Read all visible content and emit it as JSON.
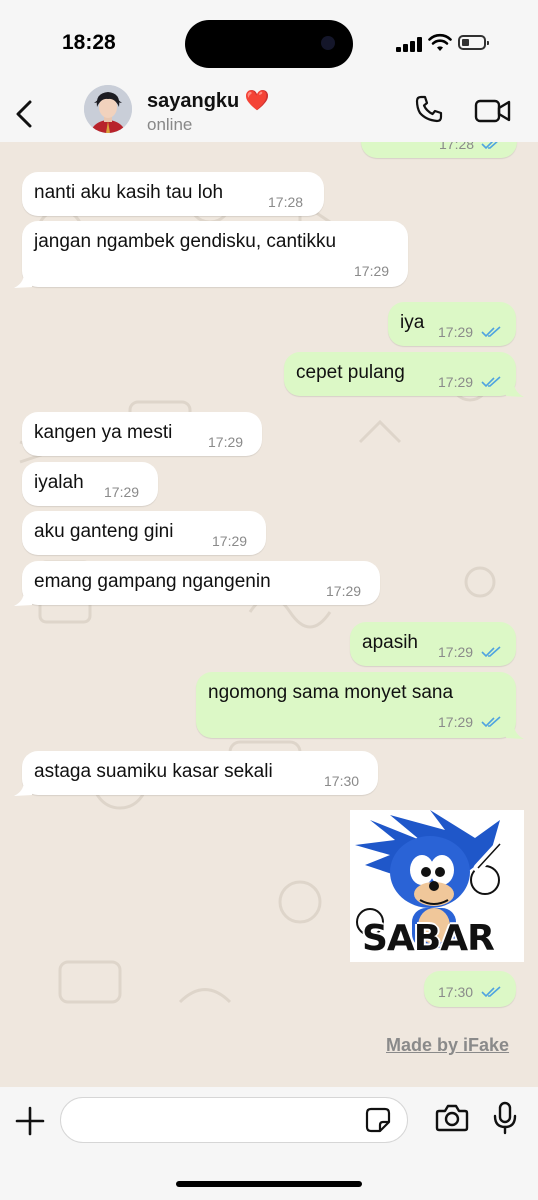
{
  "status_bar": {
    "time": "18:28"
  },
  "header": {
    "contact_name": "sayangku ❤️",
    "contact_status": "online"
  },
  "messages": [
    {
      "dir": "out",
      "text": "",
      "time": "17:28"
    },
    {
      "dir": "in",
      "text": "nanti aku kasih tau loh",
      "time": "17:28"
    },
    {
      "dir": "in",
      "text": "jangan ngambek gendisku, cantikku",
      "time": "17:29"
    },
    {
      "dir": "out",
      "text": "iya",
      "time": "17:29"
    },
    {
      "dir": "out",
      "text": "cepet pulang",
      "time": "17:29"
    },
    {
      "dir": "in",
      "text": "kangen ya mesti",
      "time": "17:29"
    },
    {
      "dir": "in",
      "text": "iyalah",
      "time": "17:29"
    },
    {
      "dir": "in",
      "text": "aku ganteng gini",
      "time": "17:29"
    },
    {
      "dir": "in",
      "text": "emang gampang ngangenin",
      "time": "17:29"
    },
    {
      "dir": "out",
      "text": "apasih",
      "time": "17:29"
    },
    {
      "dir": "out",
      "text": "ngomong sama monyet sana",
      "time": "17:29"
    },
    {
      "dir": "in",
      "text": "astaga suamiku kasar sekali",
      "time": "17:30"
    },
    {
      "dir": "out",
      "text": "",
      "time": "17:30"
    }
  ],
  "sticker": {
    "caption": "SABAR",
    "type": "sonic-sticker"
  },
  "watermark": "Made by iFake",
  "colors": {
    "incoming": "#ffffff",
    "outgoing": "#dcf8c6",
    "ticks": "#4fa3e0",
    "background": "#efe7de"
  },
  "composer": {
    "placeholder": ""
  }
}
